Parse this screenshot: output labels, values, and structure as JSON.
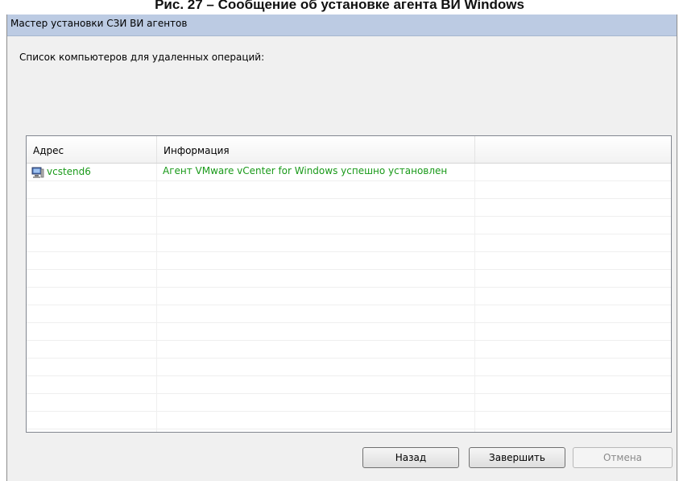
{
  "caption": "Рис. 27 – Сообщение об установке агента ВИ Windows",
  "window": {
    "title": "Мастер установки СЗИ ВИ агентов",
    "section_label": "Список компьютеров для удаленных операций:"
  },
  "table": {
    "columns": [
      "Адрес",
      "Информация",
      ""
    ],
    "rows": [
      {
        "address": "vcstend6",
        "info": "Агент VMware vCenter for Windows успешно установлен",
        "icon": "computer-icon",
        "text_color": "#1a9a1a"
      }
    ]
  },
  "buttons": {
    "back": "Назад",
    "finish": "Завершить",
    "cancel": "Отмена"
  },
  "colors": {
    "titlebar": "#bccbe3",
    "success_text": "#1a9a1a"
  }
}
